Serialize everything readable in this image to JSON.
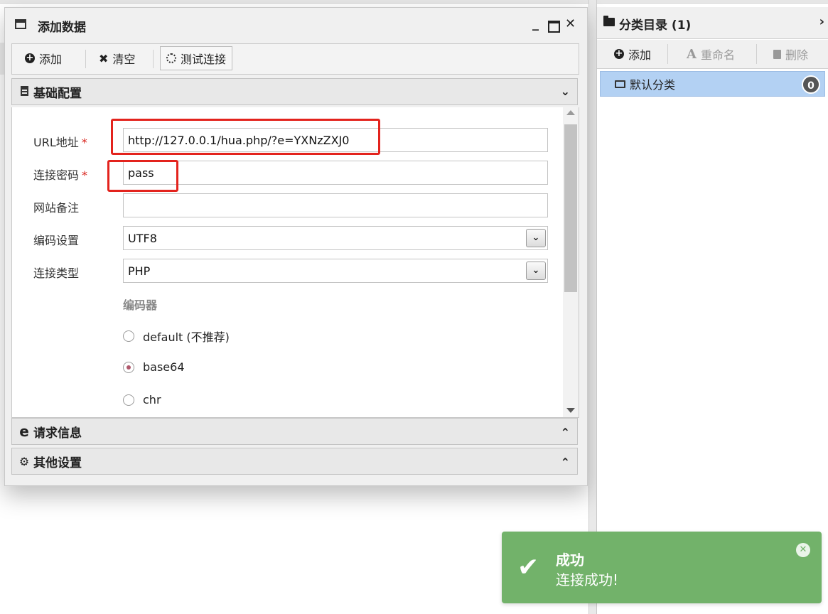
{
  "dialog": {
    "title": "添加数据",
    "controls": {
      "minimize": "_",
      "close": "✕"
    },
    "toolbar": {
      "add_label": "添加",
      "clear_label": "清空",
      "test_label": "测试连接"
    },
    "sections": {
      "basic": "基础配置",
      "request": "请求信息",
      "other": "其他设置"
    },
    "form": {
      "url_label": "URL地址",
      "url_value": "http://127.0.0.1/hua.php/?e=YXNzZXJ0",
      "password_label": "连接密码",
      "password_value": "pass",
      "note_label": "网站备注",
      "note_value": "",
      "encoding_label": "编码设置",
      "encoding_value": "UTF8",
      "type_label": "连接类型",
      "type_value": "PHP",
      "required_mark": "*",
      "encoder_label": "编码器",
      "encoders": [
        {
          "label": "default (不推荐)",
          "checked": false
        },
        {
          "label": "base64",
          "checked": true
        },
        {
          "label": "chr",
          "checked": false
        }
      ]
    }
  },
  "category_panel": {
    "title": "分类目录 (1)",
    "add_label": "添加",
    "rename_label": "重命名",
    "delete_label": "删除",
    "items": [
      {
        "label": "默认分类",
        "count": "0"
      }
    ]
  },
  "toast": {
    "title": "成功",
    "message": "连接成功!",
    "color": "#72b26a"
  },
  "colors": {
    "highlight": "#e3231d",
    "selected_row": "#b3d1f3",
    "required": "#d9231c"
  }
}
